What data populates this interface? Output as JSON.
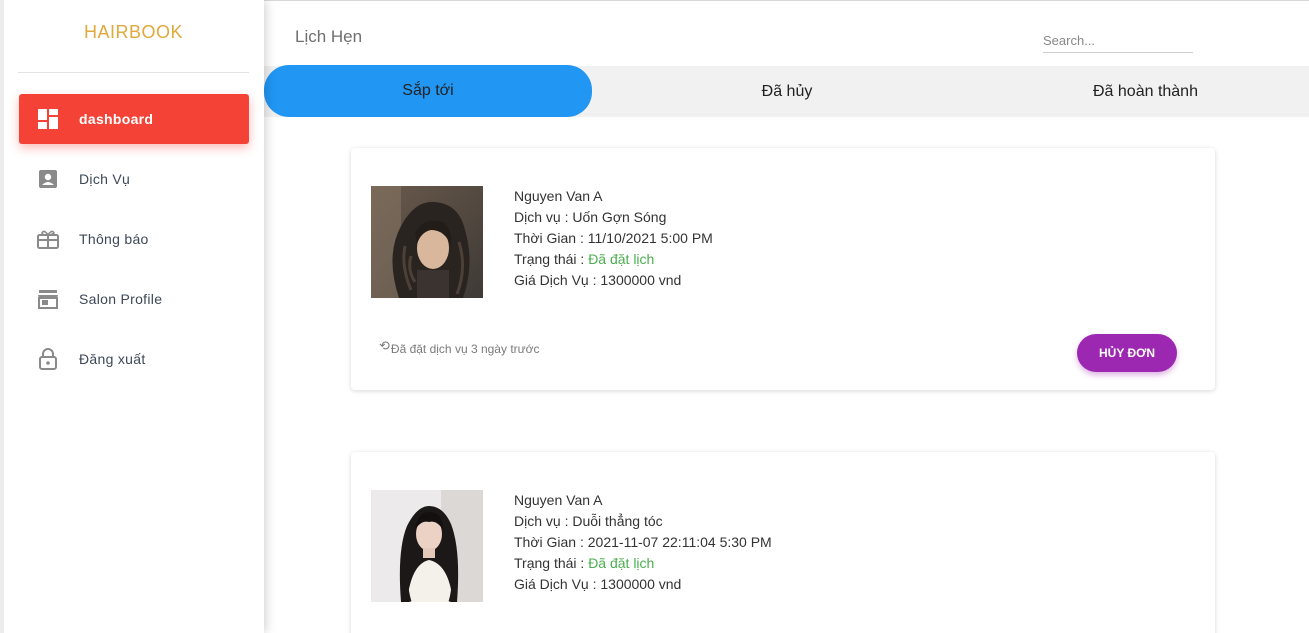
{
  "brand": "HAIRBOOK",
  "sidebar": {
    "items": [
      {
        "label": "dashboard",
        "icon": "dashboard-icon",
        "active": true
      },
      {
        "label": "Dịch Vụ",
        "icon": "person-badge-icon"
      },
      {
        "label": "Thông báo",
        "icon": "gift-icon"
      },
      {
        "label": "Salon Profile",
        "icon": "store-icon"
      },
      {
        "label": "Đăng xuất",
        "icon": "lock-icon"
      }
    ]
  },
  "header": {
    "title": "Lịch Hẹn",
    "search_placeholder": "Search..."
  },
  "tabs": [
    {
      "label": "Sắp tới",
      "active": true
    },
    {
      "label": "Đã hủy"
    },
    {
      "label": "Đã hoàn thành"
    }
  ],
  "appointments": [
    {
      "customer": "Nguyen Van A",
      "service_label": "Dịch vụ : ",
      "service": "Uốn Gợn Sóng",
      "time_label": "Thời Gian : ",
      "time": "11/10/2021 5:00 PM",
      "status_label": "Trạng thái : ",
      "status": "Đã đặt lịch",
      "price_label": "Giá Dịch Vụ : ",
      "price": "1300000 vnd",
      "booked_ago": "Đã đặt dịch vụ 3 ngày trước",
      "cancel_label": "HỦY ĐƠN"
    },
    {
      "customer": "Nguyen Van A",
      "service_label": "Dịch vụ : ",
      "service": "Duỗi thẳng tóc",
      "time_label": "Thời Gian : ",
      "time": "2021-11-07 22:11:04 5:30 PM",
      "status_label": "Trạng thái : ",
      "status": "Đã đặt lịch",
      "price_label": "Giá Dịch Vụ : ",
      "price": "1300000 vnd"
    }
  ],
  "colors": {
    "brand": "#e0a93b",
    "active_nav": "#f44336",
    "active_tab": "#2196f3",
    "status": "#4caf50",
    "cancel_button": "#9c27b0"
  }
}
